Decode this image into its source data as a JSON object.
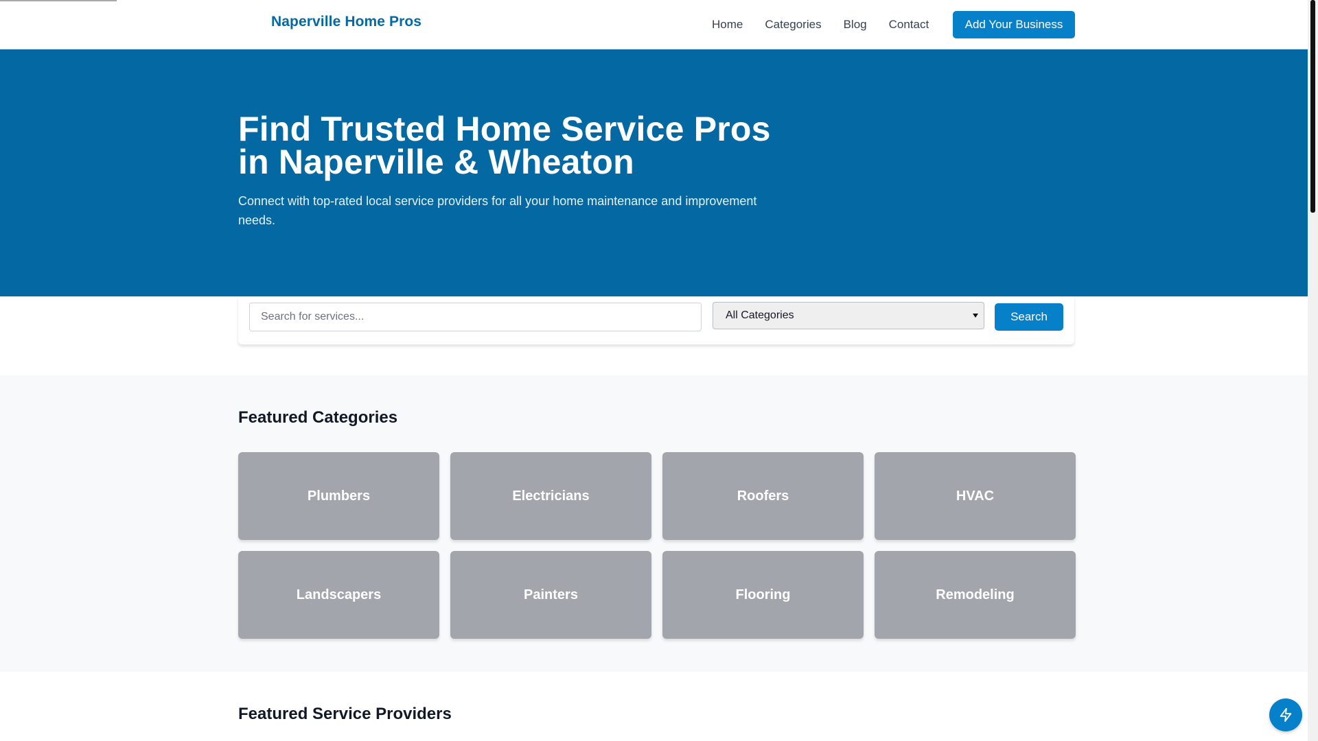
{
  "header": {
    "brand": "Naperville Home Pros",
    "nav": [
      "Home",
      "Categories",
      "Blog",
      "Contact"
    ],
    "cta": "Add Your Business"
  },
  "hero": {
    "title_line1": "Find Trusted Home Service Pros",
    "title_line2": "in Naperville & Wheaton",
    "subtitle": "Connect with top-rated local service providers for all your home maintenance and improvement needs."
  },
  "search": {
    "placeholder": "Search for services...",
    "category_selected": "All Categories",
    "button": "Search"
  },
  "featured_categories": {
    "title": "Featured Categories",
    "items": [
      "Plumbers",
      "Electricians",
      "Roofers",
      "HVAC",
      "Landscapers",
      "Painters",
      "Flooring",
      "Remodeling"
    ]
  },
  "featured_providers": {
    "title": "Featured Service Providers"
  },
  "icons": {
    "fab": "lightning-bolt-icon",
    "select": "caret-down-icon"
  },
  "colors": {
    "brand": "#0569a4",
    "hero_bg": "#0469a3",
    "button": "#0681c9",
    "category_card": "#a2a5ac",
    "section_bg": "#f8f9fb"
  }
}
